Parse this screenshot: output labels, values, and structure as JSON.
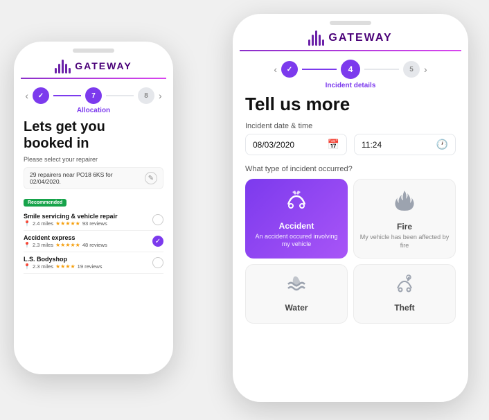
{
  "app": {
    "name": "GATEWAY"
  },
  "small_phone": {
    "logo": "GATEWAY",
    "steps": [
      {
        "label": "✓",
        "state": "done"
      },
      {
        "label": "7",
        "state": "active"
      },
      {
        "label": "8",
        "state": "inactive"
      }
    ],
    "step_label": "Allocation",
    "title_line1": "Lets get you",
    "title_line2": "booked in",
    "subtitle": "Please select your repairer",
    "location_text": "29 repairers near PO18 6KS for 02/04/2020.",
    "recommended_label": "Recommended",
    "repairers": [
      {
        "name": "Smile servicing & vehicle repair",
        "distance": "2.4 miles",
        "stars": "★★★★★",
        "reviews": "93 reviews",
        "selected": false
      },
      {
        "name": "Accident express",
        "distance": "2.3 miles",
        "stars": "★★★★★",
        "reviews": "48 reviews",
        "selected": true
      },
      {
        "name": "L.S. Bodyshop",
        "distance": "2.3 miles",
        "stars": "★★★★",
        "reviews": "19 reviews",
        "selected": false
      }
    ]
  },
  "large_phone": {
    "logo": "GATEWAY",
    "steps": [
      {
        "label": "✓",
        "state": "done"
      },
      {
        "label": "4",
        "state": "active"
      },
      {
        "label": "5",
        "state": "inactive"
      }
    ],
    "step_label": "Incident details",
    "title": "Tell us more",
    "date_label": "Incident date & time",
    "date_value": "08/03/2020",
    "time_value": "11:24",
    "incident_label": "What type of incident occurred?",
    "incidents": [
      {
        "name": "Accident",
        "desc": "An accident occured involving my vehicle",
        "icon": "🚗",
        "active": true
      },
      {
        "name": "Fire",
        "desc": "My vehicle has been affected by fire",
        "icon": "🔥",
        "active": false
      },
      {
        "name": "Water",
        "desc": "",
        "icon": "🌊",
        "active": false
      },
      {
        "name": "Theft",
        "desc": "",
        "icon": "🔓",
        "active": false
      }
    ]
  }
}
